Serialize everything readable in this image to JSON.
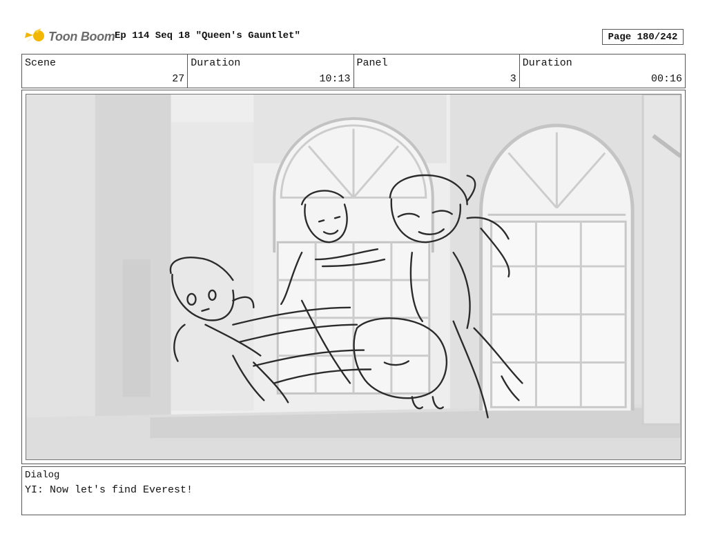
{
  "header": {
    "logo_text": "Toon Boom",
    "episode_title": "Ep 114 Seq 18 \"Queen's Gauntlet\"",
    "page": "Page 180/242"
  },
  "info": {
    "scene_label": "Scene",
    "scene_value": "27",
    "scene_duration_label": "Duration",
    "scene_duration_value": "10:13",
    "panel_label": "Panel",
    "panel_value": "3",
    "panel_duration_label": "Duration",
    "panel_duration_value": "00:16"
  },
  "dialog": {
    "label": "Dialog",
    "text": "YI: Now let's find Everest!"
  },
  "colors": {
    "logo_accent": "#f2b705",
    "logo_text": "#6b6b6b",
    "border": "#555555"
  }
}
